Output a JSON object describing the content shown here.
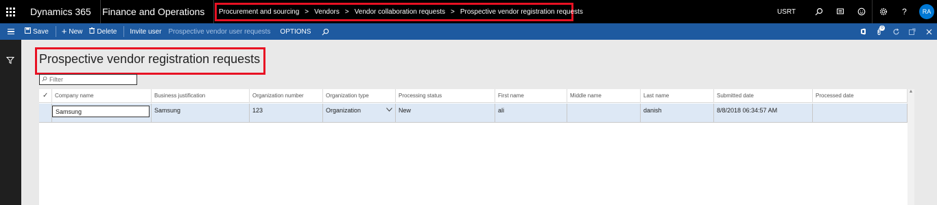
{
  "topbar": {
    "app_name": "Dynamics 365",
    "module_name": "Finance and Operations",
    "breadcrumbs": [
      "Procurement and sourcing",
      "Vendors",
      "Vendor collaboration requests",
      "Prospective vendor registration requests"
    ],
    "company": "USRT",
    "avatar_initials": "RA"
  },
  "actionbar": {
    "save": "Save",
    "new": "New",
    "delete": "Delete",
    "invite_user": "Invite user",
    "prospective_vendor_user_requests": "Prospective vendor user requests",
    "options": "OPTIONS",
    "notification_count": "0"
  },
  "page": {
    "title": "Prospective vendor registration requests",
    "filter_placeholder": "Filter"
  },
  "grid": {
    "columns": [
      "Company name",
      "Business justification",
      "Organization number",
      "Organization type",
      "Processing status",
      "First name",
      "Middle name",
      "Last name",
      "Submitted date",
      "Processed date"
    ],
    "rows": [
      {
        "company_name": "Samsung",
        "business_justification": "Samsung",
        "organization_number": "123",
        "organization_type": "Organization",
        "processing_status": "New",
        "first_name": "ali",
        "middle_name": "",
        "last_name": "danish",
        "submitted_date": "8/8/2018 06:34:57 AM",
        "processed_date": ""
      }
    ]
  },
  "colors": {
    "topbar": "#000000",
    "actionbar": "#1e5aa0",
    "highlight_border": "#e81123",
    "selected_row": "#dde8f5",
    "avatar": "#0078d4"
  }
}
